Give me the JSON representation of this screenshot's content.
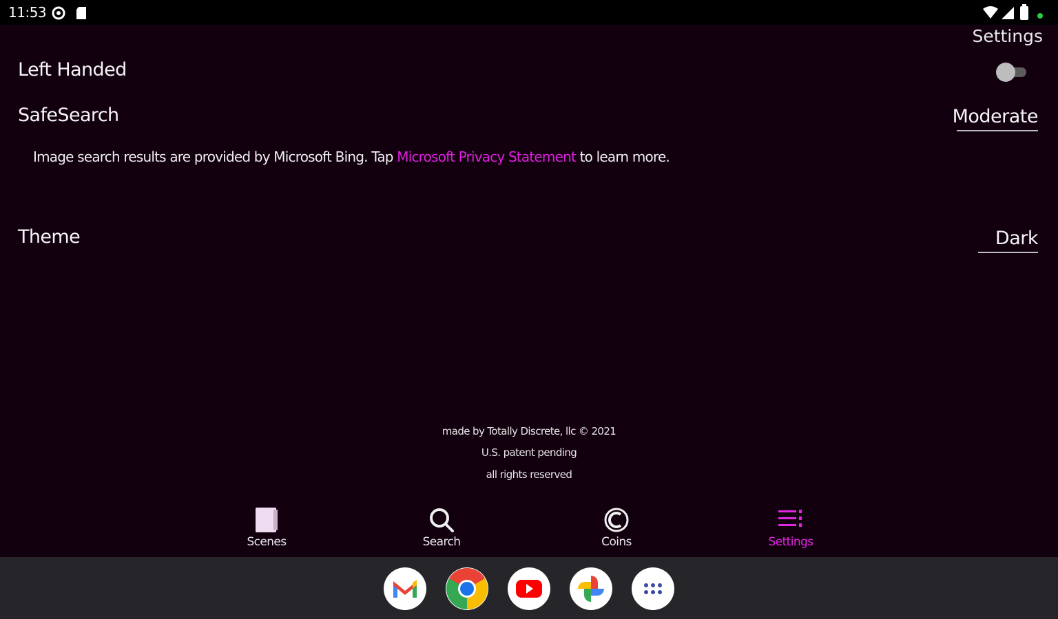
{
  "status_bar": {
    "time": "11:53",
    "left_icons": [
      "data-saver-icon",
      "sd-card-icon"
    ],
    "right_icons": [
      "wifi-icon",
      "cellular-signal-icon",
      "battery-icon",
      "privacy-dot-icon"
    ]
  },
  "header": {
    "title": "Settings"
  },
  "settings": {
    "left_handed": {
      "label": "Left Handed",
      "enabled": false
    },
    "safesearch": {
      "label": "SafeSearch",
      "value": "Moderate"
    },
    "notice": {
      "prefix": "Image search results are provided by Microsoft Bing. Tap ",
      "link": "Microsoft Privacy Statement",
      "suffix": " to learn more."
    },
    "theme": {
      "label": "Theme",
      "value": "Dark"
    }
  },
  "footer": {
    "line1": "made by Totally Discrete, llc © 2021",
    "line2": "U.S. patent pending",
    "line3": "all rights reserved"
  },
  "bottom_nav": {
    "items": [
      {
        "label": "Scenes",
        "icon": "scenes-icon"
      },
      {
        "label": "Search",
        "icon": "search-icon"
      },
      {
        "label": "Coins",
        "icon": "coins-icon"
      },
      {
        "label": "Settings",
        "icon": "settings-menu-icon"
      }
    ],
    "active": "Settings"
  },
  "dock": {
    "apps": [
      "Gmail",
      "Chrome",
      "YouTube",
      "Photos",
      "App drawer"
    ]
  },
  "colors": {
    "background": "#12000f",
    "accent": "#e028e0",
    "status_bar": "#000000",
    "taskbar": "#26262a"
  }
}
